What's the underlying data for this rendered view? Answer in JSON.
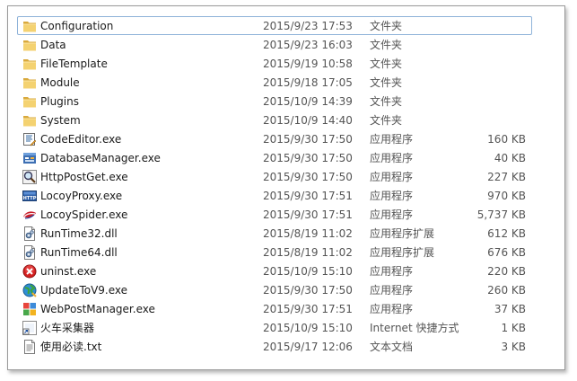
{
  "files": [
    {
      "name": "Configuration",
      "date": "2015/9/23 17:53",
      "type": "文件夹",
      "size": "",
      "icon": "folder-icon",
      "selected": true
    },
    {
      "name": "Data",
      "date": "2015/9/23 16:03",
      "type": "文件夹",
      "size": "",
      "icon": "folder-icon"
    },
    {
      "name": "FileTemplate",
      "date": "2015/9/19 10:58",
      "type": "文件夹",
      "size": "",
      "icon": "folder-icon"
    },
    {
      "name": "Module",
      "date": "2015/9/18 17:05",
      "type": "文件夹",
      "size": "",
      "icon": "folder-icon"
    },
    {
      "name": "Plugins",
      "date": "2015/10/9 14:39",
      "type": "文件夹",
      "size": "",
      "icon": "folder-icon"
    },
    {
      "name": "System",
      "date": "2015/10/9 14:40",
      "type": "文件夹",
      "size": "",
      "icon": "folder-icon"
    },
    {
      "name": "CodeEditor.exe",
      "date": "2015/9/30 17:50",
      "type": "应用程序",
      "size": "160 KB",
      "icon": "code-editor-icon"
    },
    {
      "name": "DatabaseManager.exe",
      "date": "2015/9/30 17:50",
      "type": "应用程序",
      "size": "40 KB",
      "icon": "database-icon"
    },
    {
      "name": "HttpPostGet.exe",
      "date": "2015/9/30 17:50",
      "type": "应用程序",
      "size": "227 KB",
      "icon": "magnifier-icon"
    },
    {
      "name": "LocoyProxy.exe",
      "date": "2015/9/30 17:51",
      "type": "应用程序",
      "size": "970 KB",
      "icon": "http-proxy-icon"
    },
    {
      "name": "LocoySpider.exe",
      "date": "2015/9/30 17:51",
      "type": "应用程序",
      "size": "5,737 KB",
      "icon": "spider-icon"
    },
    {
      "name": "RunTime32.dll",
      "date": "2015/8/19 11:02",
      "type": "应用程序扩展",
      "size": "612 KB",
      "icon": "dll-gear-icon"
    },
    {
      "name": "RunTime64.dll",
      "date": "2015/8/19 11:02",
      "type": "应用程序扩展",
      "size": "676 KB",
      "icon": "dll-gear-icon"
    },
    {
      "name": "uninst.exe",
      "date": "2015/10/9 15:10",
      "type": "应用程序",
      "size": "220 KB",
      "icon": "uninstall-icon"
    },
    {
      "name": "UpdateToV9.exe",
      "date": "2015/9/30 17:50",
      "type": "应用程序",
      "size": "260 KB",
      "icon": "globe-update-icon"
    },
    {
      "name": "WebPostManager.exe",
      "date": "2015/9/30 17:51",
      "type": "应用程序",
      "size": "37 KB",
      "icon": "webpost-icon"
    },
    {
      "name": "火车采集器",
      "date": "2015/10/9 15:10",
      "type": "Internet 快捷方式",
      "size": "1 KB",
      "icon": "shortcut-icon"
    },
    {
      "name": "使用必读.txt",
      "date": "2015/9/17 12:06",
      "type": "文本文档",
      "size": "3 KB",
      "icon": "text-document-icon"
    }
  ],
  "colors": {
    "folder": "#e8c05a",
    "selection_border": "#8fb3d9",
    "meta_text": "#555555"
  }
}
